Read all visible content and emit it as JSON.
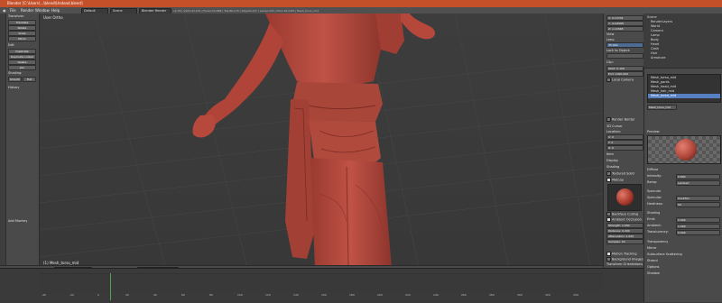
{
  "window": {
    "title": "Blender [C:\\Users\\...\\blend\\Undead.blend]",
    "controls": [
      "–",
      "□",
      "✕"
    ]
  },
  "menubar": {
    "items": [
      "File",
      "Render",
      "Window",
      "Help"
    ],
    "layout": "Default",
    "scene": "Scene",
    "engine": "Blender Render",
    "info": "v2.78 | Verts:43,231 | Faces:43,088 | Tris:86,176 | Objects:0/7 | Lamps:0/0 | Mem:94.02M | Mesh_torso_mid"
  },
  "toolshelf": {
    "section_transform": "Transform",
    "buttons": [
      "Translate",
      "Rotate",
      "Scale",
      "Mirror"
    ],
    "section_edit": "Edit",
    "edit_buttons": [
      "Duplicate",
      "Duplicate Linked",
      "Delete",
      "Join"
    ],
    "shading_label": "Shading:",
    "shading_buttons": [
      "Smooth",
      "Flat"
    ],
    "history": "History",
    "operator_panel": "Add Monkey"
  },
  "viewport": {
    "label": "User Ortho",
    "object_label": "(1) Mesh_torso_mid"
  },
  "npanel": {
    "fields": [
      "X: 0.13702",
      "Y: -0.04568",
      "Z: 1.10348"
    ],
    "section_view": "View",
    "lens_label": "Lens:",
    "lens": "35.000",
    "lock_label": "Lock to Object:",
    "clip_label": "Clip:",
    "clip_start": "Start: 0.100",
    "clip_end": "End: 1000.000",
    "local_camera": "Local Camera",
    "render_border": "Render Border",
    "cursor_label": "3D Cursor",
    "cursor_location": "Location:",
    "cursor_fields": [
      "X: 0",
      "Y: 0",
      "Z: 0"
    ],
    "item": "Item",
    "display": "Display",
    "shading": "Shading",
    "textured_solid": "Textured Solid",
    "matcap": "Matcap",
    "backface": "Backface Culling",
    "ao": "Ambient Occlusion",
    "ao_fields": [
      "Strength: 1.000",
      "Distance: 0.200",
      "Attenuation: 1.000",
      "Samples: 20"
    ],
    "motion_tracking": "Motion Tracking",
    "bg_images": "Background Images",
    "transform_orient": "Transform Orientations",
    "global": "Global"
  },
  "outliner": {
    "items": [
      "Scene",
      "RenderLayers",
      "World",
      "Camera",
      "Lamp",
      "Body",
      "Head",
      "Cloth",
      "Hair",
      "Armature"
    ]
  },
  "properties": {
    "materials": [
      "Mesh_torso_mid",
      "Mesh_pants",
      "Mesh_head_mid",
      "Mesh_hair_mid",
      "Mesh_torso_mid"
    ],
    "material_name": "Mesh_torso_mid",
    "preview": "Preview",
    "diffuse": "Diffuse",
    "specular": "Specular",
    "shading": "Shading",
    "transparency": "Transparency",
    "mirror": "Mirror",
    "sss": "Subsurface Scattering",
    "strand": "Strand",
    "options": "Options",
    "shadow": "Shadow",
    "rows": [
      {
        "label": "Intensity:",
        "value": "0.800"
      },
      {
        "label": "Ramp:",
        "value": "Lambert"
      },
      {
        "label": "Specular:",
        "value": "CookTorr"
      },
      {
        "label": "Hardness:",
        "value": "50"
      },
      {
        "label": "Emit:",
        "value": "0.000"
      },
      {
        "label": "Ambient:",
        "value": "1.000"
      },
      {
        "label": "Translucency:",
        "value": "0.000"
      }
    ]
  },
  "toolbar": {
    "view": "View",
    "select": "Select",
    "add": "Add",
    "object": "Object",
    "mode": "Sculpt Mode",
    "pivot": "⊙",
    "layers": "Layers"
  },
  "timeline": {
    "menu": [
      "View",
      "Marker",
      "Frame",
      "Playback"
    ],
    "start": "Start: 1",
    "end": "End: 250",
    "frame": "1",
    "sync": "No Sync",
    "ticks": [
      "-40",
      "-20",
      "0",
      "20",
      "40",
      "60",
      "80",
      "100",
      "120",
      "140",
      "160",
      "180",
      "200",
      "220",
      "240",
      "260",
      "280",
      "300",
      "320",
      "340"
    ]
  },
  "colors": {
    "skin": "#b8493d",
    "titlebar": "#c4502a",
    "bg": "#3d3d3d"
  }
}
